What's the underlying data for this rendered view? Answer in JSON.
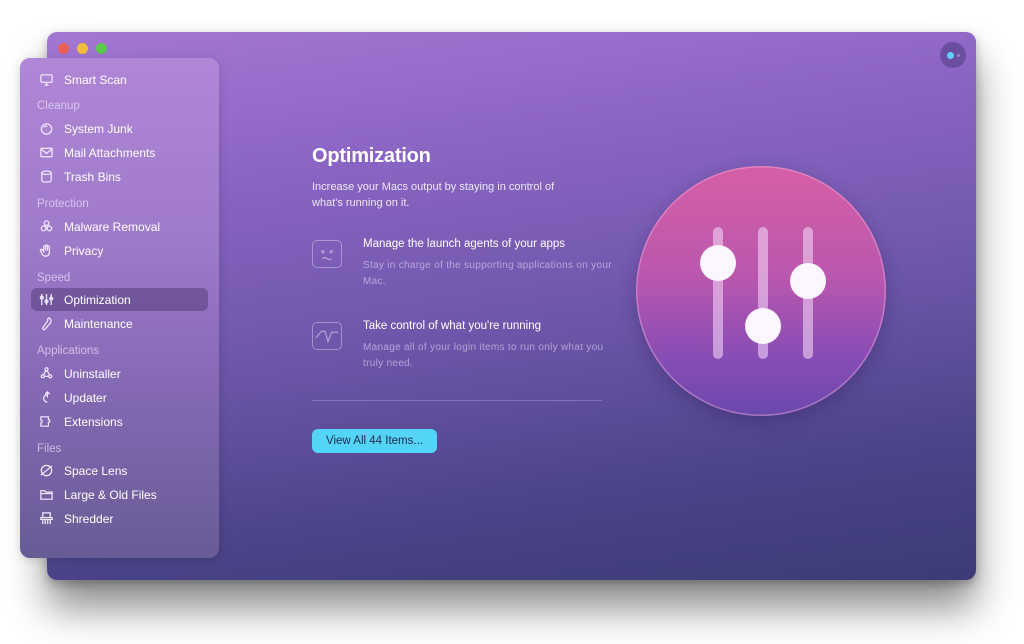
{
  "window": {
    "traffic_lights": [
      "close",
      "minimize",
      "zoom"
    ],
    "assistant_icon": "assistant-orb-icon"
  },
  "sidebar": {
    "top_item": {
      "label": "Smart Scan",
      "icon": "monitor-icon"
    },
    "sections": [
      {
        "label": "Cleanup",
        "items": [
          {
            "label": "System Junk",
            "icon": "system-junk-icon"
          },
          {
            "label": "Mail Attachments",
            "icon": "envelope-icon"
          },
          {
            "label": "Trash Bins",
            "icon": "trash-bin-icon"
          }
        ]
      },
      {
        "label": "Protection",
        "items": [
          {
            "label": "Malware Removal",
            "icon": "biohazard-icon"
          },
          {
            "label": "Privacy",
            "icon": "hand-icon"
          }
        ]
      },
      {
        "label": "Speed",
        "items": [
          {
            "label": "Optimization",
            "icon": "sliders-icon",
            "active": true
          },
          {
            "label": "Maintenance",
            "icon": "wrench-icon"
          }
        ]
      },
      {
        "label": "Applications",
        "items": [
          {
            "label": "Uninstaller",
            "icon": "uninstaller-icon"
          },
          {
            "label": "Updater",
            "icon": "updater-arrow-icon"
          },
          {
            "label": "Extensions",
            "icon": "puzzle-icon"
          }
        ]
      },
      {
        "label": "Files",
        "items": [
          {
            "label": "Space Lens",
            "icon": "planet-icon"
          },
          {
            "label": "Large & Old Files",
            "icon": "folder-icon"
          },
          {
            "label": "Shredder",
            "icon": "shredder-icon"
          }
        ]
      }
    ]
  },
  "main": {
    "title": "Optimization",
    "subtitle": "Increase your Macs output by staying in control of what's running on it.",
    "features": [
      {
        "heading": "Manage the launch agents of your apps",
        "description": "Stay in charge of the supporting applications on your Mac.",
        "icon": "dizzy-face-icon"
      },
      {
        "heading": "Take control of what you're running",
        "description": "Manage all of your login items to run only what you truly need.",
        "icon": "activity-monitor-icon"
      }
    ],
    "view_all_button": "View All 44 Items...",
    "hero_icon": "sliders-hero-icon"
  },
  "colors": {
    "accent_button": "#54d4f6",
    "hero_top": "#d65fa6",
    "hero_bottom": "#6a48ac"
  }
}
